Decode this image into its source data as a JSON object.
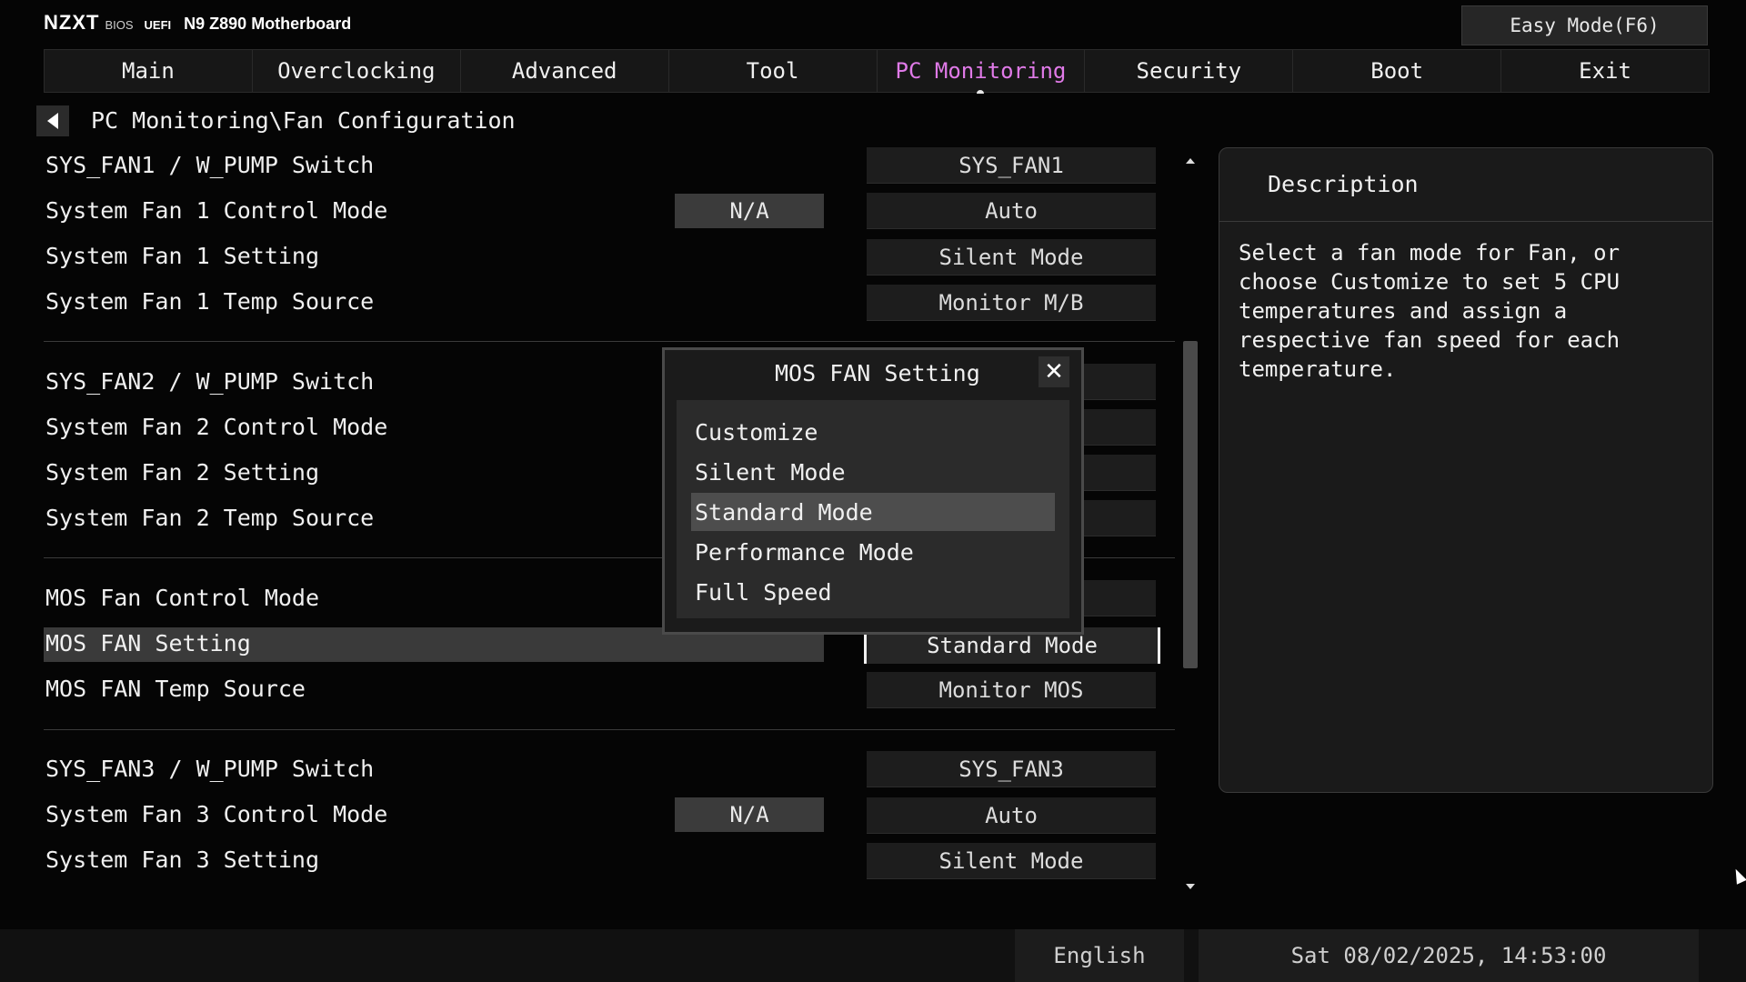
{
  "header": {
    "brand": "NZXT",
    "bios_label": "BIOS",
    "uefi_label": "UEFI",
    "model": "N9 Z890 Motherboard",
    "easy_mode_label": "Easy Mode(F6)"
  },
  "tabs": [
    {
      "label": "Main"
    },
    {
      "label": "Overclocking"
    },
    {
      "label": "Advanced"
    },
    {
      "label": "Tool"
    },
    {
      "label": "PC Monitoring",
      "active": true
    },
    {
      "label": "Security"
    },
    {
      "label": "Boot"
    },
    {
      "label": "Exit"
    }
  ],
  "breadcrumb": "PC Monitoring\\Fan Configuration",
  "settings": {
    "sys_fan1_switch": {
      "label": "SYS_FAN1 / W_PUMP Switch",
      "value": "SYS_FAN1"
    },
    "sys_fan1_control_mode": {
      "label": "System Fan 1 Control Mode",
      "status": "N/A",
      "value": "Auto"
    },
    "sys_fan1_setting": {
      "label": "System Fan 1 Setting",
      "value": "Silent Mode"
    },
    "sys_fan1_temp_source": {
      "label": "System Fan 1 Temp Source",
      "value": "Monitor M/B"
    },
    "sys_fan2_switch": {
      "label": "SYS_FAN2 / W_PUMP Switch"
    },
    "sys_fan2_control_mode": {
      "label": "System Fan 2 Control Mode"
    },
    "sys_fan2_setting": {
      "label": "System Fan 2 Setting"
    },
    "sys_fan2_temp_source": {
      "label": "System Fan 2 Temp Source"
    },
    "mos_fan_control_mode": {
      "label": "MOS Fan  Control Mode"
    },
    "mos_fan_setting": {
      "label": "MOS FAN Setting",
      "value": "Standard Mode"
    },
    "mos_fan_temp_source": {
      "label": "MOS FAN Temp Source",
      "value": "Monitor MOS"
    },
    "sys_fan3_switch": {
      "label": "SYS_FAN3 / W_PUMP Switch",
      "value": "SYS_FAN3"
    },
    "sys_fan3_control_mode": {
      "label": "System Fan 3 Control Mode",
      "status": "N/A",
      "value": "Auto"
    },
    "sys_fan3_setting": {
      "label": "System Fan 3 Setting",
      "value": "Silent Mode"
    }
  },
  "description": {
    "title": "Description",
    "text": "Select a fan mode for Fan, or choose Customize to set 5 CPU temperatures and assign a respective fan speed for each temperature."
  },
  "modal": {
    "title": "MOS FAN Setting",
    "options": [
      "Customize",
      "Silent Mode",
      "Standard Mode",
      "Performance Mode",
      "Full Speed"
    ],
    "selected_index": 2
  },
  "footer": {
    "language": "English",
    "datetime": "Sat 08/02/2025, 14:53:00"
  }
}
